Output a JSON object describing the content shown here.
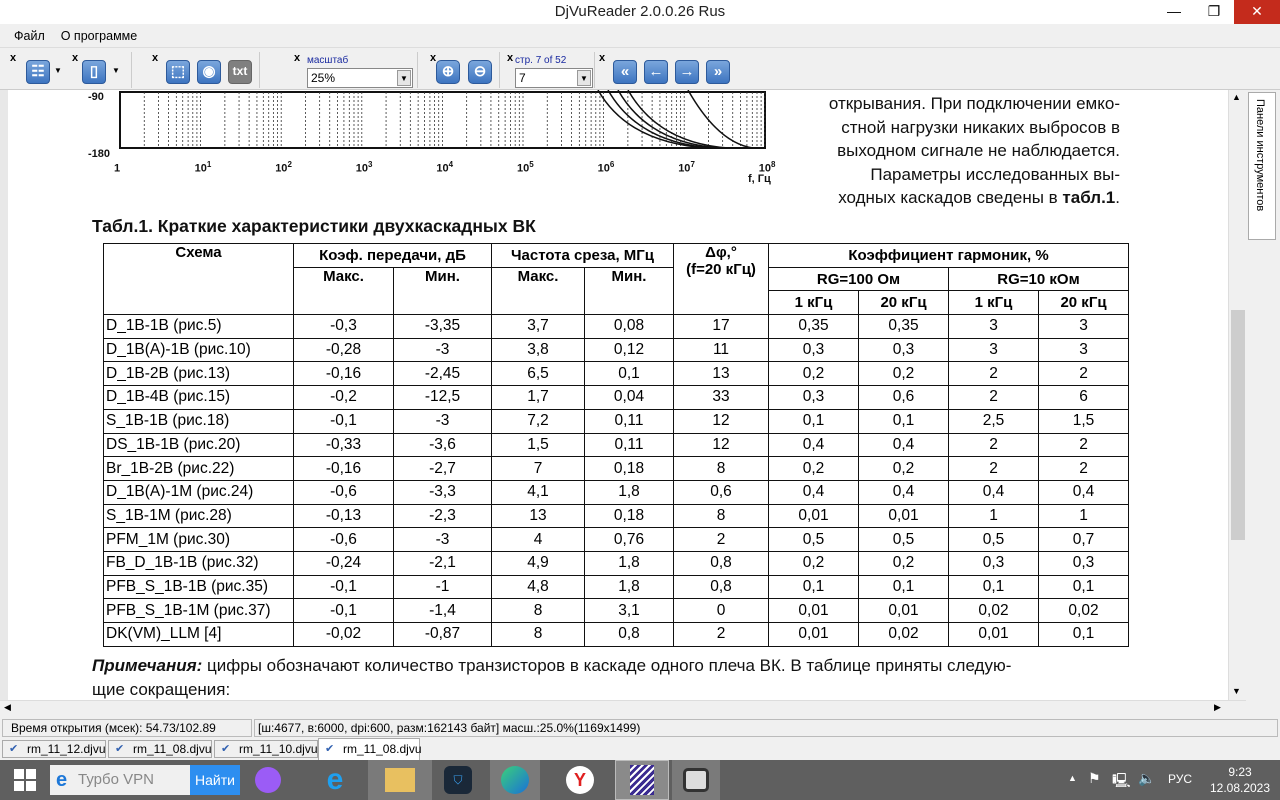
{
  "window": {
    "title": "DjVuReader 2.0.0.26 Rus"
  },
  "menu": [
    "Файл",
    "О программе"
  ],
  "toolbar": {
    "zoom_label": "масштаб",
    "zoom_value": "25%",
    "page_label": "стр. 7 of 52",
    "page_value": "7",
    "txt_button": "txt"
  },
  "side_panel": "Панели инструментов",
  "graph": {
    "y_ticks": [
      "-90",
      "-180"
    ],
    "x_ticks": [
      "1",
      "10",
      "10",
      "10",
      "10",
      "10",
      "10",
      "10",
      "10"
    ],
    "x_exp": [
      "",
      "1",
      "2",
      "3",
      "4",
      "5",
      "6",
      "7",
      "8"
    ],
    "x_unit": "f, Гц"
  },
  "paragraph": [
    "открывания. При подключении емко-",
    "стной нагрузки никаких выбросов в",
    "выходном сигнале не наблюдается.",
    "Параметры исследованных вы-",
    "ходных каскадов сведены в "
  ],
  "paragraph_ref": "табл.1",
  "paragraph_end": ".",
  "table": {
    "caption": "Табл.1. Краткие характеристики двухкаскадных ВК",
    "h_scheme": "Схема",
    "h_gain": "Коэф. передачи, дБ",
    "h_freq": "Частота среза, МГц",
    "h_phase1": "Δφ,°",
    "h_phase2": "(f=20 кГц)",
    "h_thd": "Коэффициент гармоник, %",
    "h_rg100": "RG=100 Ом",
    "h_rg10k": "RG=10 кОм",
    "max": "Макс.",
    "min": "Мин.",
    "f1": "1 кГц",
    "f20": "20 кГц",
    "rows": [
      [
        "D_1B-1B (рис.5)",
        "-0,3",
        "-3,35",
        "3,7",
        "0,08",
        "17",
        "0,35",
        "0,35",
        "3",
        "3"
      ],
      [
        "D_1B(A)-1B (рис.10)",
        "-0,28",
        "-3",
        "3,8",
        "0,12",
        "11",
        "0,3",
        "0,3",
        "3",
        "3"
      ],
      [
        "D_1B-2B (рис.13)",
        "-0,16",
        "-2,45",
        "6,5",
        "0,1",
        "13",
        "0,2",
        "0,2",
        "2",
        "2"
      ],
      [
        "D_1B-4B (рис.15)",
        "-0,2",
        "-12,5",
        "1,7",
        "0,04",
        "33",
        "0,3",
        "0,6",
        "2",
        "6"
      ],
      [
        "S_1B-1B (рис.18)",
        "-0,1",
        "-3",
        "7,2",
        "0,11",
        "12",
        "0,1",
        "0,1",
        "2,5",
        "1,5"
      ],
      [
        "DS_1B-1B (рис.20)",
        "-0,33",
        "-3,6",
        "1,5",
        "0,11",
        "12",
        "0,4",
        "0,4",
        "2",
        "2"
      ],
      [
        "Br_1B-2B (рис.22)",
        "-0,16",
        "-2,7",
        "7",
        "0,18",
        "8",
        "0,2",
        "0,2",
        "2",
        "2"
      ],
      [
        "D_1B(A)-1M (рис.24)",
        "-0,6",
        "-3,3",
        "4,1",
        "1,8",
        "0,6",
        "0,4",
        "0,4",
        "0,4",
        "0,4"
      ],
      [
        "S_1B-1M (рис.28)",
        "-0,13",
        "-2,3",
        "13",
        "0,18",
        "8",
        "0,01",
        "0,01",
        "1",
        "1"
      ],
      [
        "PFM_1M (рис.30)",
        "-0,6",
        "-3",
        "4",
        "0,76",
        "2",
        "0,5",
        "0,5",
        "0,5",
        "0,7"
      ],
      [
        "FB_D_1B-1B (рис.32)",
        "-0,24",
        "-2,1",
        "4,9",
        "1,8",
        "0,8",
        "0,2",
        "0,2",
        "0,3",
        "0,3"
      ],
      [
        "PFB_S_1B-1B (рис.35)",
        "-0,1",
        "-1",
        "4,8",
        "1,8",
        "0,8",
        "0,1",
        "0,1",
        "0,1",
        "0,1"
      ],
      [
        "PFB_S_1B-1M (рис.37)",
        "-0,1",
        "-1,4",
        "8",
        "3,1",
        "0",
        "0,01",
        "0,01",
        "0,02",
        "0,02"
      ],
      [
        "DK(VM)_LLM [4]",
        "-0,02",
        "-0,87",
        "8",
        "0,8",
        "2",
        "0,01",
        "0,02",
        "0,01",
        "0,1"
      ]
    ]
  },
  "note_label": "Примечания:",
  "note_text": " цифры обозначают количество транзисторов в каскаде одного плеча ВК. В таблице приняты следую-",
  "note_text2": "щие сокращения:",
  "status": {
    "open_time": "Время открытия (мсек): 54.73/102.89",
    "info": "[ш:4677, в:6000, dpi:600, разм:162143 байт] масш.:25.0%(1169x1499)"
  },
  "tabs": [
    "rm_11_12.djvu",
    "rm_11_08.djvu",
    "rm_11_10.djvu",
    "rm_11_08.djvu"
  ],
  "taskbar": {
    "search_placeholder": "Турбо VPN",
    "search_button": "Найти",
    "lang": "РУС",
    "time": "9:23",
    "date": "12.08.2023"
  }
}
